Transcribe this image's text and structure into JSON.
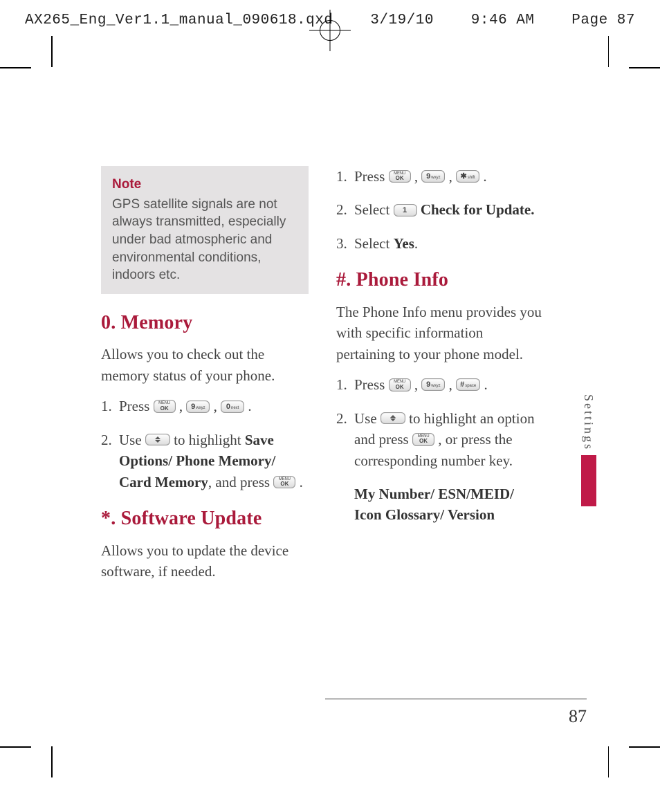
{
  "slug": {
    "file": "AX265_Eng_Ver1.1_manual_090618.qxd",
    "date": "3/19/10",
    "time": "9:46 AM",
    "page": "Page 87"
  },
  "page_number": "87",
  "side_label": "Settings",
  "note": {
    "title": "Note",
    "body": "GPS satellite signals are not always transmitted, especially under bad atmospheric and environmental conditions, indoors etc."
  },
  "memory": {
    "heading": "0. Memory",
    "intro": "Allows you to check out the memory status of your phone.",
    "step1_a": "Press ",
    "step1_b": ", ",
    "step1_c": ", ",
    "step1_d": " .",
    "step2_a": "Use ",
    "step2_b": " to highlight ",
    "step2_bold": "Save Options/ Phone Memory/ Card Memory",
    "step2_c": ", and press ",
    "step2_d": " ."
  },
  "software": {
    "heading": "*. Software Update",
    "intro": "Allows you to update the device software, if needed.",
    "step1_a": "Press ",
    "step1_b": ", ",
    "step1_c": ", ",
    "step1_d": " .",
    "step2_a": "Select ",
    "step2_bold": " Check for Update.",
    "step3_a": "Select ",
    "step3_bold": "Yes",
    "step3_b": "."
  },
  "phoneinfo": {
    "heading": "#. Phone Info",
    "intro": "The Phone Info menu provides you with specific information pertaining to your phone model.",
    "step1_a": "Press ",
    "step1_b": ", ",
    "step1_c": ", ",
    "step1_d": " .",
    "step2_a": "Use ",
    "step2_b": " to highlight an option and press ",
    "step2_c": " , or press the corresponding number key.",
    "list": "My Number/ ESN/MEID/ Icon Glossary/ Version"
  },
  "keys": {
    "ok_top": "MENU",
    "ok_bot": "OK",
    "k9_big": "9",
    "k9_sm": "wxyz",
    "k0_big": "0",
    "k0_sm": "next",
    "k1_big": "1",
    "k1_sm": "",
    "kstar_big": "✱",
    "kstar_sm": "shift",
    "khash_big": "#",
    "khash_sm": "space"
  }
}
